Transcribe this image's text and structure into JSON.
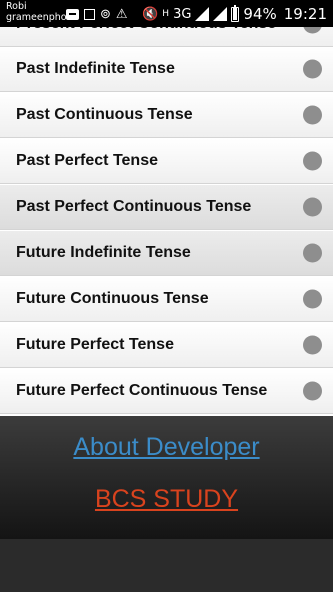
{
  "status_bar": {
    "carrier_line1": "Robi",
    "carrier_line2": "grameenphone",
    "network": "3G",
    "battery": "94%",
    "time": "19:21"
  },
  "list": {
    "partial_item": "Present Perfect Continuous Tense",
    "items": [
      "Past Indefinite Tense",
      "Past Continuous Tense",
      "Past Perfect Tense",
      "Past Perfect Continuous Tense",
      "Future Indefinite Tense",
      "Future Continuous Tense",
      "Future Perfect Tense",
      "Future Perfect Continuous Tense"
    ]
  },
  "footer": {
    "about_label": "About Developer",
    "bcs_label": "BCS STUDY",
    "about_color": "#3b8cc9",
    "bcs_color": "#d9431e"
  }
}
